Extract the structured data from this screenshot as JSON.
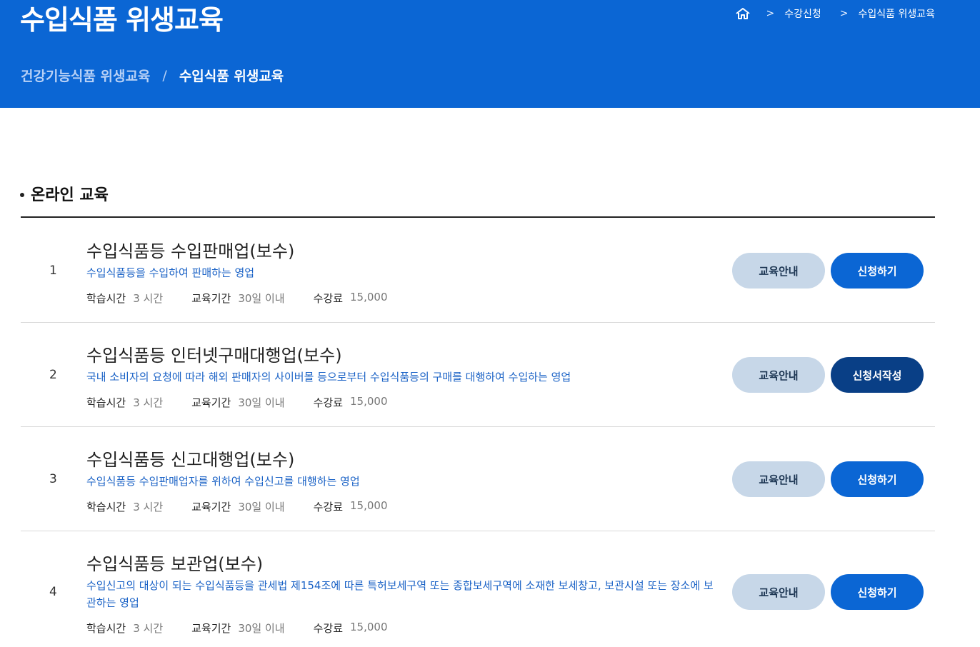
{
  "header": {
    "title": "수입식품 위생교육",
    "breadcrumb": [
      "수강신청",
      "수입식품 위생교육"
    ],
    "subnav": {
      "parent": "건강기능식품 위생교육",
      "separator": "/",
      "current": "수입식품 위생교육"
    }
  },
  "section": {
    "title": "온라인 교육"
  },
  "labels": {
    "study_time": "학습시간",
    "period": "교육기간",
    "fee": "수강료"
  },
  "courses": [
    {
      "num": "1",
      "name": "수입식품등 수입판매업(보수)",
      "desc": "수입식품등을 수입하여 판매하는 영업",
      "study_time": "3 시간",
      "period": "30일 이내",
      "fee": "15,000",
      "info_label": "교육안내",
      "apply_label": "신청하기"
    },
    {
      "num": "2",
      "name": "수입식품등 인터넷구매대행업(보수)",
      "desc": "국내 소비자의 요청에 따라 해외 판매자의 사이버몰 등으로부터 수입식품등의 구매를 대행하여 수입하는 영업",
      "study_time": "3 시간",
      "period": "30일 이내",
      "fee": "15,000",
      "info_label": "교육안내",
      "apply_label": "신청서작성"
    },
    {
      "num": "3",
      "name": "수입식품등 신고대행업(보수)",
      "desc": "수입식품등 수입판매업자를 위하여 수입신고를 대행하는 영업",
      "study_time": "3 시간",
      "period": "30일 이내",
      "fee": "15,000",
      "info_label": "교육안내",
      "apply_label": "신청하기"
    },
    {
      "num": "4",
      "name": "수입식품등 보관업(보수)",
      "desc": "수입신고의 대상이 되는 수입식품등을 관세법 제154조에 따른 특허보세구역 또는 종합보세구역에 소재한 보세창고, 보관시설 또는 장소에 보관하는 영업",
      "study_time": "3 시간",
      "period": "30일 이내",
      "fee": "15,000",
      "info_label": "교육안내",
      "apply_label": "신청하기"
    }
  ],
  "colors": {
    "banner": "#0b66d4",
    "apply_button": "#0b66d4",
    "apply_button_active": "#093f86",
    "info_button": "#c7d7e8",
    "description_text": "#1a62c6"
  },
  "icons": {
    "home": "home-icon",
    "separator": "chevron-right-icon"
  }
}
